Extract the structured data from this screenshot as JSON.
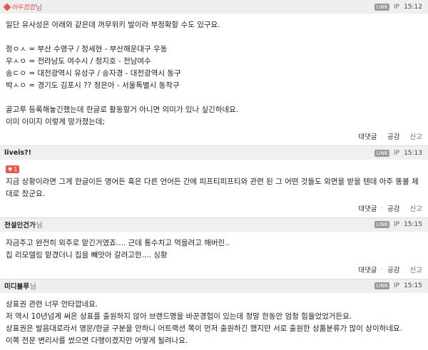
{
  "common": {
    "link_badge": "LINK",
    "ip_label": "IP",
    "reply_label": "대댓글",
    "sympathy_label": "공감",
    "report_label": "신고",
    "suffix": "님"
  },
  "comments": [
    {
      "author": "",
      "time": "15:12",
      "lines": [
        "일단 유사성은 아래와 같은데 꺼무위키 발이라 부정확할 수도 있구요.",
        "",
        "정ㅇㅅ = 부산 수영구 / 정세현 - 부산해운대구 우동",
        "우ㅅㅇ = 전라남도 여수시 / 정지호 - 전남여수",
        "송ㄷㅇ = 대전광역시 유성구 / 송자경 - 대전광역시 동구",
        "박ㅅㅇ = 경기도 김포시 ?? 정은아 - 서울특별시 동작구",
        "",
        "골고루 등록해놓긴했는데 한글로 활동할거 아니면 의미가 있나 싶긴하네요.",
        "이미 이미지 이렇게 망가졌는데;"
      ]
    },
    {
      "author": "liveis?!",
      "time": "15:13",
      "likes": "1",
      "lines": [
        "지금 상황이라면 그게 한글이든 영어든 혹은 다른 언어든 간에 피프티피프티와 관련 된 그 어떤 것들도 외면을 받을 텐데 아주 똥볼 제",
        "대로 찼군요."
      ]
    },
    {
      "author": "전설인건가",
      "time": "15:15",
      "lines": [
        "자금주고 완전히 외주로 맡긴거였죠.... 근데 통수치고 먹을려고 해버린..",
        "집 리모델링 맡겼더니 집을 빼앗아 갈려고한.... 싱황"
      ]
    },
    {
      "author": "미디블루",
      "time": "15:15",
      "lines": [
        "상표권 관련 너무 안타깝네요.",
        "저 역시 10년넘게 써온 상표를 출원하지 않아 브랜드명을 바꾼경험이 있는데 정말 한동안 엄청 힘들었었거든요.",
        "상표권은 발음대로라서 영문/한글 구분을 안하니 어트랙션 쪽이 먼저 출원하긴 했지만 서로 출원한 상품분류가 많이 상이하네요.",
        "이쪽 전문 변리사를 썼으면 다행이겠지만 어떻게 될려나요."
      ]
    }
  ]
}
